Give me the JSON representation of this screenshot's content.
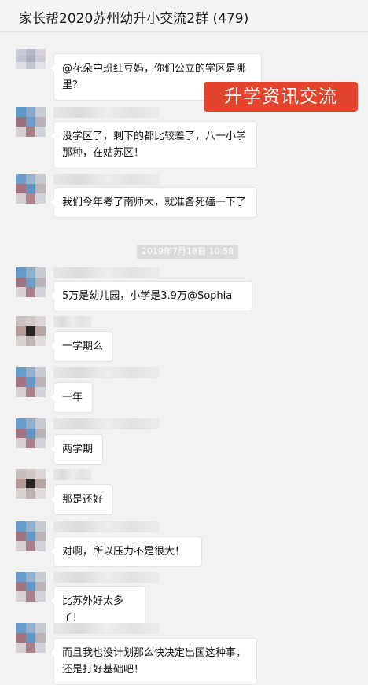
{
  "window": {
    "title": "家长帮2020苏州幼升小交流2群 (479)"
  },
  "watermark": "升学资讯交流",
  "timestamp": "2019年7月18日 10:58",
  "messages": [
    {
      "text": "@花朵中班红豆妈，你们公立的学区是哪里？",
      "sender_blurred": true
    },
    {
      "text": "没学区了，剩下的都比较差了，八一小学那种，在姑苏区！",
      "sender_blurred": true
    },
    {
      "text": "我们今年考了南师大，就准备死磕一下了",
      "sender_blurred": true
    },
    {
      "text": "5万是幼儿园，小学是3.9万@Sophia",
      "sender_blurred": true
    },
    {
      "text": "一学期么",
      "sender_blurred": true
    },
    {
      "text": "一年",
      "sender_blurred": true
    },
    {
      "text": "两学期",
      "sender_blurred": true
    },
    {
      "text": "那是还好",
      "sender_blurred": true
    },
    {
      "text": "对啊，所以压力不是很大！",
      "sender_blurred": true
    },
    {
      "text": "比苏外好太多了！",
      "sender_blurred": true
    },
    {
      "text": "而且我也没计划那么快决定出国这种事，还是打好基础吧！",
      "sender_blurred": true
    }
  ],
  "colors": {
    "watermark_bg": "#e2452c",
    "bubble_bg": "#ffffff",
    "chat_bg": "#f2f2f2"
  }
}
